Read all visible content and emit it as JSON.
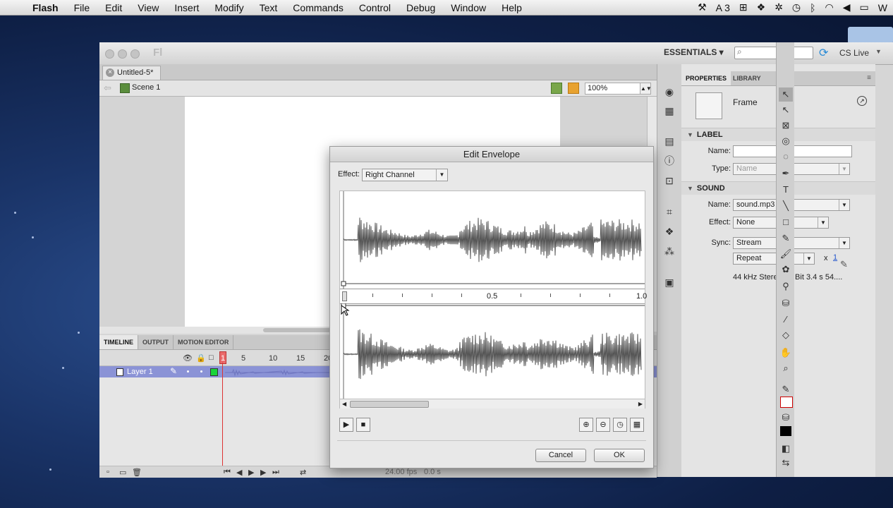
{
  "menubar": {
    "app_name": "Flash",
    "items": [
      "File",
      "Edit",
      "View",
      "Insert",
      "Modify",
      "Text",
      "Commands",
      "Control",
      "Debug",
      "Window",
      "Help"
    ],
    "status_a3": "A 3"
  },
  "window": {
    "workspace": "ESSENTIALS ▾",
    "cs_live": "CS Live",
    "doc_tab": "Untitled-5*",
    "scene": "Scene 1",
    "zoom": "100%"
  },
  "timeline": {
    "tabs": [
      "TIMELINE",
      "OUTPUT",
      "MOTION EDITOR"
    ],
    "frame_numbers": [
      "1",
      "5",
      "10",
      "15",
      "20"
    ],
    "layer_name": "Layer 1",
    "fps": "24.00 fps",
    "time": "0.0 s"
  },
  "properties": {
    "tabs": [
      "PROPERTIES",
      "LIBRARY"
    ],
    "type": "Frame",
    "label_section": "LABEL",
    "name_label": "Name:",
    "name_value": "",
    "type_label": "Type:",
    "type_value": "Name",
    "sound_section": "SOUND",
    "sound_name_label": "Name:",
    "sound_name_value": "sound.mp3",
    "effect_label": "Effect:",
    "effect_value": "None",
    "sync_label": "Sync:",
    "sync_value": "Stream",
    "repeat_value": "Repeat",
    "repeat_x": "x",
    "repeat_count": "1",
    "sound_info": "44 kHz Stereo 16 Bit 3.4 s 54...."
  },
  "dialog": {
    "title": "Edit Envelope",
    "effect_label": "Effect:",
    "effect_value": "Right Channel",
    "ruler_labels": [
      "0.5",
      "1.0"
    ],
    "cancel": "Cancel",
    "ok": "OK"
  },
  "colors": {
    "layer_highlight": "#8b93d6",
    "playhead": "#dd3333",
    "waveform": "#555555"
  }
}
